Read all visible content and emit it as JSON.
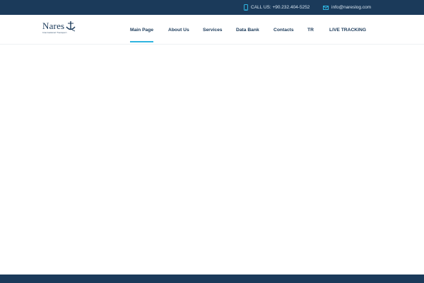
{
  "topbar": {
    "phone_icon": "phone-icon",
    "phone_text": "CALL US: +90.232.404-5252",
    "email_icon": "envelope-icon",
    "email_text": "info@nareslog.com"
  },
  "logo": {
    "wordmark": "Nares",
    "tagline": "International Transport"
  },
  "nav": {
    "items": [
      {
        "label": "Main Page",
        "active": true
      },
      {
        "label": "About Us",
        "active": false
      },
      {
        "label": "Services",
        "active": false
      },
      {
        "label": "Data Bank",
        "active": false
      },
      {
        "label": "Contacts",
        "active": false
      },
      {
        "label": "TR",
        "active": false
      },
      {
        "label": "LIVE TRACKING",
        "active": false
      }
    ]
  },
  "colors": {
    "brand_navy": "#1b3a5a",
    "accent_cyan": "#2fb4e0"
  }
}
